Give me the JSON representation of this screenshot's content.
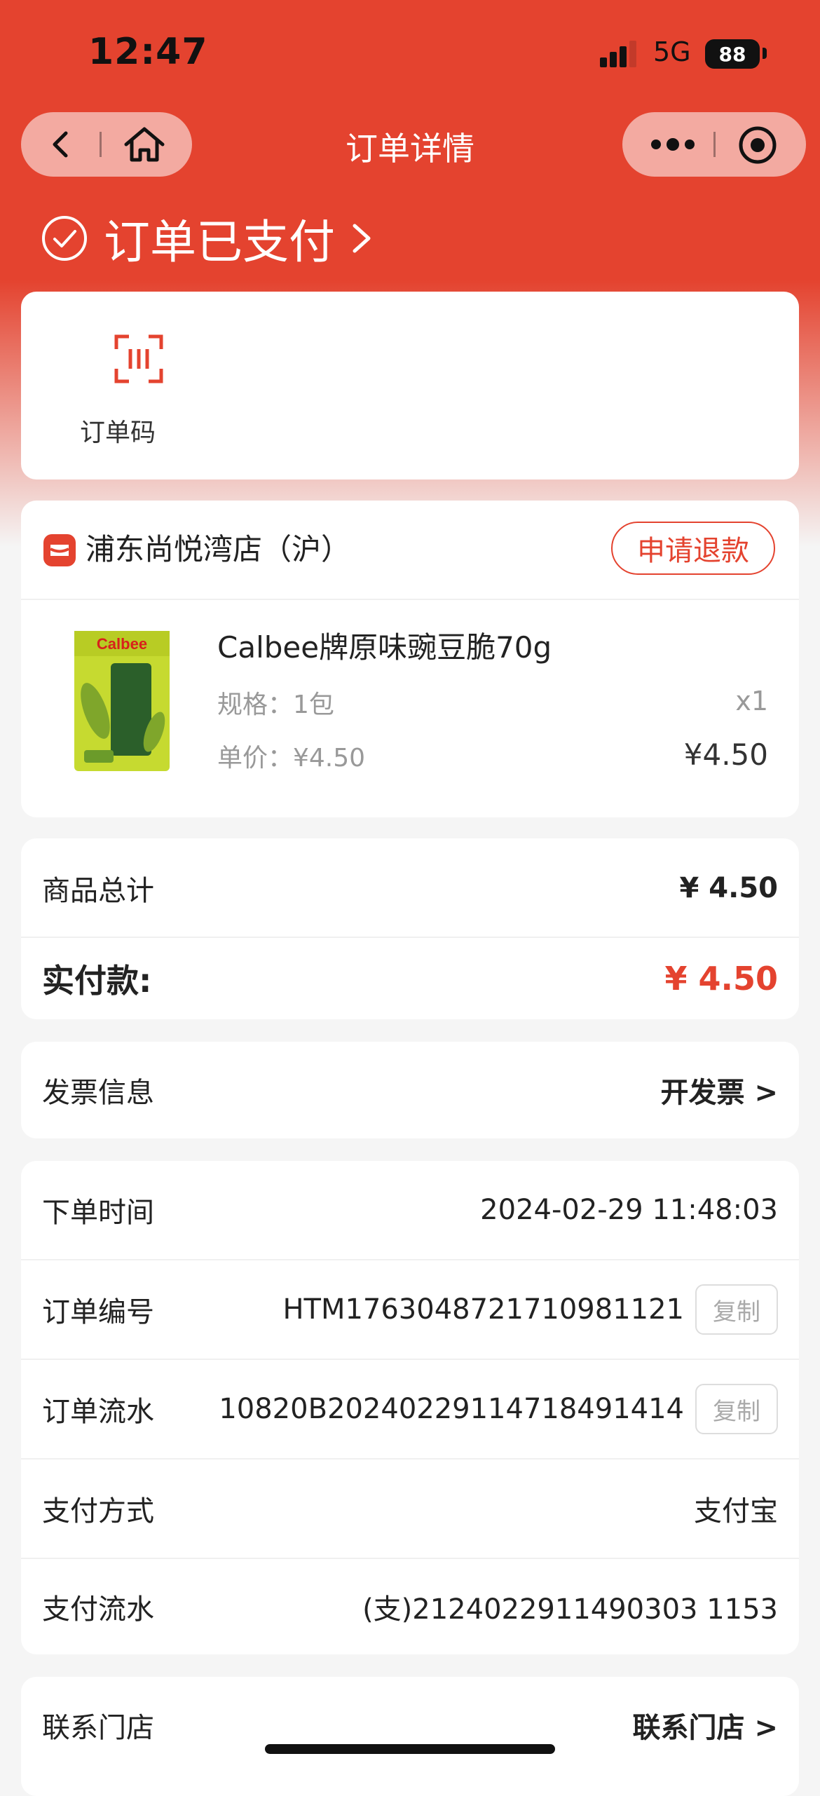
{
  "status_bar": {
    "time": "12:47",
    "network": "5G",
    "battery": "88"
  },
  "nav": {
    "title": "订单详情"
  },
  "order_status": {
    "text": "订单已支付",
    "arrow": ">"
  },
  "quick_actions": {
    "order_code_label": "订单码"
  },
  "store": {
    "name": "浦东尚悦湾店（沪）",
    "refund_label": "申请退款"
  },
  "product": {
    "name": "Calbee牌原味豌豆脆70g",
    "spec": "规格：1包",
    "unit_price": "单价：¥4.50",
    "quantity": "x1",
    "price": "¥4.50",
    "image_brand": "Calbee"
  },
  "summary": {
    "total_label": "商品总计",
    "total_value": "¥ 4.50",
    "paid_label": "实付款:",
    "paid_value": "¥ 4.50"
  },
  "invoice": {
    "label": "发票信息",
    "action": "开发票 >"
  },
  "details": {
    "order_time_label": "下单时间",
    "order_time": "2024-02-29 11:48:03",
    "order_no_label": "订单编号",
    "order_no": "HTM1763048721710981121",
    "serial_label": "订单流水",
    "serial": "10820B20240229114718491414",
    "pay_method_label": "支付方式",
    "pay_method": "支付宝",
    "pay_serial_label": "支付流水",
    "pay_serial": "(支)2124022911490303 1153",
    "copy_label": "复制"
  },
  "contact": {
    "label": "联系门店",
    "action": "联系门店 >"
  },
  "colors": {
    "accent": "#e4432f",
    "background": "#f5f5f5"
  }
}
